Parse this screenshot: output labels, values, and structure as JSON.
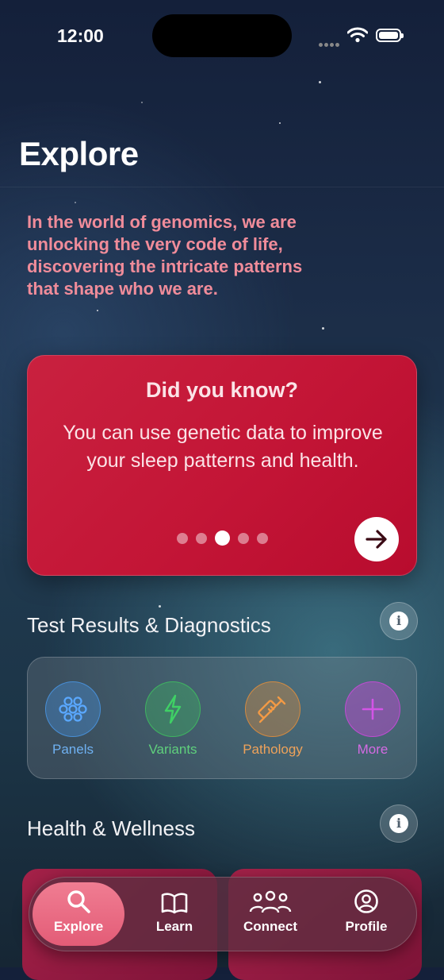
{
  "status_bar": {
    "time": "12:00"
  },
  "page": {
    "title": "Explore"
  },
  "intro_text": "In the world of genomics, we are unlocking the very code of life, discovering the intricate patterns that shape who we are.",
  "did_you_know": {
    "title": "Did you know?",
    "body": "You can use genetic data to improve your sleep patterns and health.",
    "page_count": 5,
    "active_page": 3
  },
  "sections": {
    "test_results": {
      "title": "Test Results & Diagnostics"
    },
    "health_wellness": {
      "title": "Health & Wellness"
    }
  },
  "tools": [
    {
      "label": "Panels",
      "icon": "hexagon-cluster-icon",
      "color": "#4a98e8"
    },
    {
      "label": "Variants",
      "icon": "bolt-icon",
      "color": "#3fc35f"
    },
    {
      "label": "Pathology",
      "icon": "syringe-icon",
      "color": "#e8903a"
    },
    {
      "label": "More",
      "icon": "plus-icon",
      "color": "#c64ad8"
    }
  ],
  "tab_bar": [
    {
      "label": "Explore",
      "icon": "search-icon",
      "active": true
    },
    {
      "label": "Learn",
      "icon": "book-icon",
      "active": false
    },
    {
      "label": "Connect",
      "icon": "people-icon",
      "active": false
    },
    {
      "label": "Profile",
      "icon": "person-circle-icon",
      "active": false
    }
  ],
  "colors": {
    "accent": "#c31536",
    "intro_text": "#f08c9a",
    "tab_active": "#e8697f"
  }
}
